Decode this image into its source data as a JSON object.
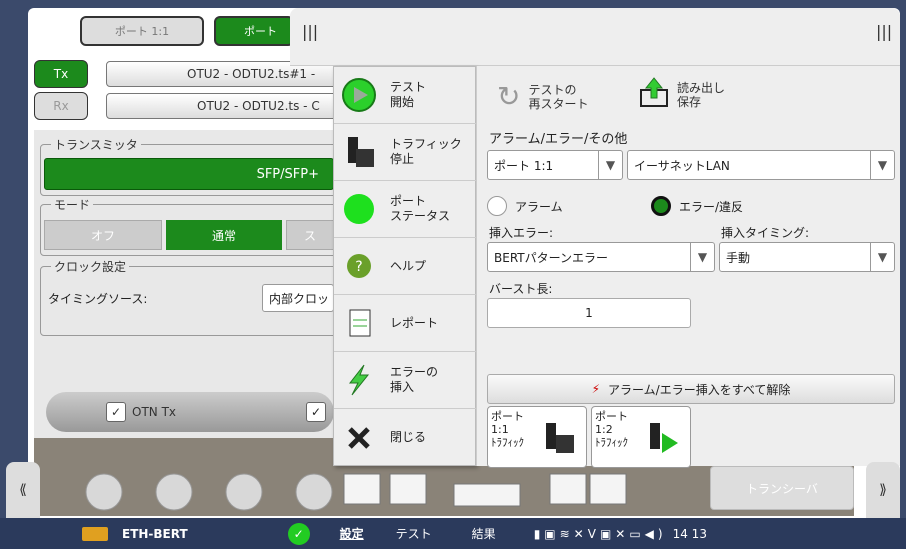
{
  "tabs": {
    "port1": "ポート 1:1",
    "port2": "ポート"
  },
  "tx_label": "Tx",
  "rx_label": "Rx",
  "tx_path": "OTU2 - ODTU2.ts#1 -",
  "rx_path": "OTU2 - ODTU2.ts - C",
  "left": {
    "transmitter_label": "トランスミッタ",
    "sfp_value": "SFP/SFP+",
    "mode_label": "モード",
    "mode_off": "オフ",
    "mode_normal": "通常",
    "mode_third": "ス",
    "clock_label": "クロック設定",
    "timing_source_label": "タイミングソース:",
    "timing_source_value": "内部クロッ",
    "otn_tx": "OTN Tx",
    "transceiver": "トランシーバ"
  },
  "menu": {
    "start_test": "テスト\n開始",
    "stop_traffic": "トラフィック\n停止",
    "port_status": "ポート\nステータス",
    "help": "ヘルプ",
    "report": "レポート",
    "inject_error": "エラーの\n挿入",
    "close": "閉じる"
  },
  "toolbar": {
    "restart": "テストの\n再スタート",
    "load_save": "読み出し\n保存"
  },
  "alarm": {
    "section_title": "アラーム/エラー/その他",
    "port_select": "ポート 1:1",
    "type_select": "イーサネットLAN",
    "radio_alarm": "アラーム",
    "radio_error": "エラー/違反",
    "insert_error_label": "挿入エラー:",
    "insert_error_value": "BERTパターンエラー",
    "insert_timing_label": "挿入タイミング:",
    "insert_timing_value": "手動",
    "burst_label": "バースト長:",
    "burst_value": "1",
    "clear_all": "アラーム/エラー挿入をすべて解除",
    "traffic1": "ポート\n1:1\nﾄﾗﾌｨｯｸ",
    "traffic2": "ポート\n1:2\nﾄﾗﾌｨｯｸ"
  },
  "status": {
    "app_name": "ETH-BERT",
    "nav_setup": "設定",
    "nav_test": "テスト",
    "nav_results": "結果",
    "time": "14 13"
  }
}
